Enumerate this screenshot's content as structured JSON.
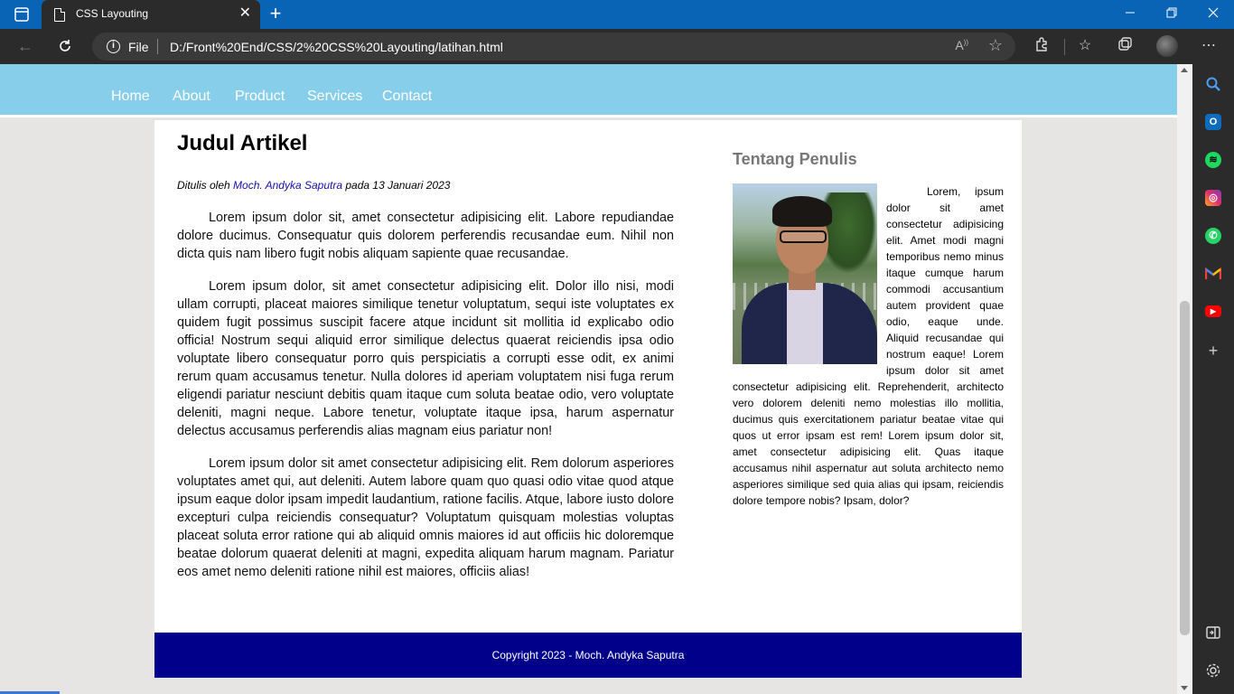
{
  "browser": {
    "tab_title": "CSS Layouting",
    "tab_close": "✕",
    "new_tab": "+",
    "scheme": "File",
    "url": "D:/Front%20End/CSS/2%20CSS%20Layouting/latihan.html",
    "icons": [
      "tab-actions-icon",
      "page-icon",
      "back-icon",
      "refresh-icon",
      "info-icon",
      "read-aloud-icon",
      "favorite-icon",
      "extensions-icon",
      "favorites-icon",
      "collections-icon",
      "profile-icon",
      "more-icon",
      "minimize-icon",
      "restore-icon",
      "close-icon"
    ]
  },
  "sidebar": {
    "items": [
      "search",
      "outlook",
      "spotify",
      "instagram",
      "whatsapp",
      "gmail",
      "youtube",
      "add"
    ],
    "bottom": [
      "split-screen",
      "settings"
    ]
  },
  "nav": {
    "items": [
      {
        "label": "Home"
      },
      {
        "label": "About"
      },
      {
        "label": "Product"
      },
      {
        "label": "Services"
      },
      {
        "label": "Contact"
      }
    ],
    "background": "#87ceeb"
  },
  "article": {
    "title": "Judul Artikel",
    "meta_prefix": "Ditulis oleh",
    "author": "Moch. Andyka Saputra",
    "meta_suffix": "pada 13 Januari 2023",
    "paragraphs": [
      "Lorem ipsum dolor sit, amet consectetur adipisicing elit. Labore repudiandae dolore ducimus. Consequatur quis dolorem perferendis recusandae eum. Nihil non dicta quis nam libero fugit nobis aliquam sapiente quae recusandae.",
      "Lorem ipsum dolor, sit amet consectetur adipisicing elit. Dolor illo nisi, modi ullam corrupti, placeat maiores similique tenetur voluptatum, sequi iste voluptates ex quidem fugit possimus suscipit facere atque incidunt sit mollitia id explicabo odio officia! Nostrum sequi aliquid error similique delectus quaerat reiciendis ipsa odio voluptate libero consequatur porro quis perspiciatis a corrupti esse odit, ex animi rerum quam accusamus tenetur. Nulla dolores id aperiam voluptatem nisi fuga rerum eligendi pariatur nesciunt debitis quam itaque cum soluta beatae odio, vero voluptate deleniti, magni neque. Labore tenetur, voluptate itaque ipsa, harum aspernatur delectus accusamus perferendis alias magnam eius pariatur non!",
      "Lorem ipsum dolor sit amet consectetur adipisicing elit. Rem dolorum asperiores voluptates amet qui, aut deleniti. Autem labore quam quo quasi odio vitae quod atque ipsum eaque dolor ipsam impedit laudantium, ratione facilis. Atque, labore iusto dolore excepturi culpa reiciendis consequatur? Voluptatum quisquam molestias voluptas placeat soluta error ratione qui ab aliquid omnis maiores id aut officiis hic doloremque beatae dolorum quaerat deleniti at magni, expedita aliquam harum magnam. Pariatur eos amet nemo deleniti ratione nihil est maiores, officiis alias!"
    ]
  },
  "aside": {
    "title": "Tentang Penulis",
    "bio": "Lorem, ipsum dolor sit amet consectetur adipisicing elit. Amet modi magni temporibus nemo minus itaque cumque harum commodi accusantium autem provident quae odio, eaque unde. Aliquid recusandae qui nostrum eaque! Lorem ipsum dolor sit amet consectetur adipisicing elit. Reprehenderit, architecto vero dolorem deleniti nemo molestias illo mollitia, ducimus quis exercitationem pariatur beatae vitae qui quos ut error ipsam est rem! Lorem ipsum dolor sit, amet consectetur adipisicing elit. Quas itaque accusamus nihil aspernatur aut soluta architecto nemo asperiores similique sed quia alias qui ipsam, reiciendis dolore tempore nobis? Ipsam, dolor?"
  },
  "footer": {
    "text": "Copyright 2023 - Moch. Andyka Saputra",
    "background": "#00008b"
  }
}
